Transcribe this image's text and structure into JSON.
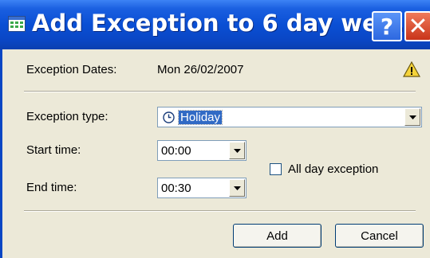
{
  "window": {
    "title": "Add Exception to 6 day we...",
    "help_label": "?",
    "close_label": "✕"
  },
  "exception_dates": {
    "label": "Exception Dates:",
    "value": "Mon 26/02/2007"
  },
  "exception_type": {
    "label": "Exception type:",
    "value": "Holiday"
  },
  "start_time": {
    "label": "Start time:",
    "value": "00:00"
  },
  "end_time": {
    "label": "End time:",
    "value": "00:30"
  },
  "all_day": {
    "label": "All day exception",
    "checked": false
  },
  "buttons": {
    "add": "Add",
    "cancel": "Cancel"
  },
  "colors": {
    "titlebar": "#0a4fd4",
    "selection": "#316ac5",
    "dialog_bg": "#ece9d8"
  },
  "icons": {
    "app": "calendar-grid-icon",
    "warning": "warning-triangle-icon",
    "type": "clock-icon",
    "dropdown": "chevron-down-icon"
  }
}
